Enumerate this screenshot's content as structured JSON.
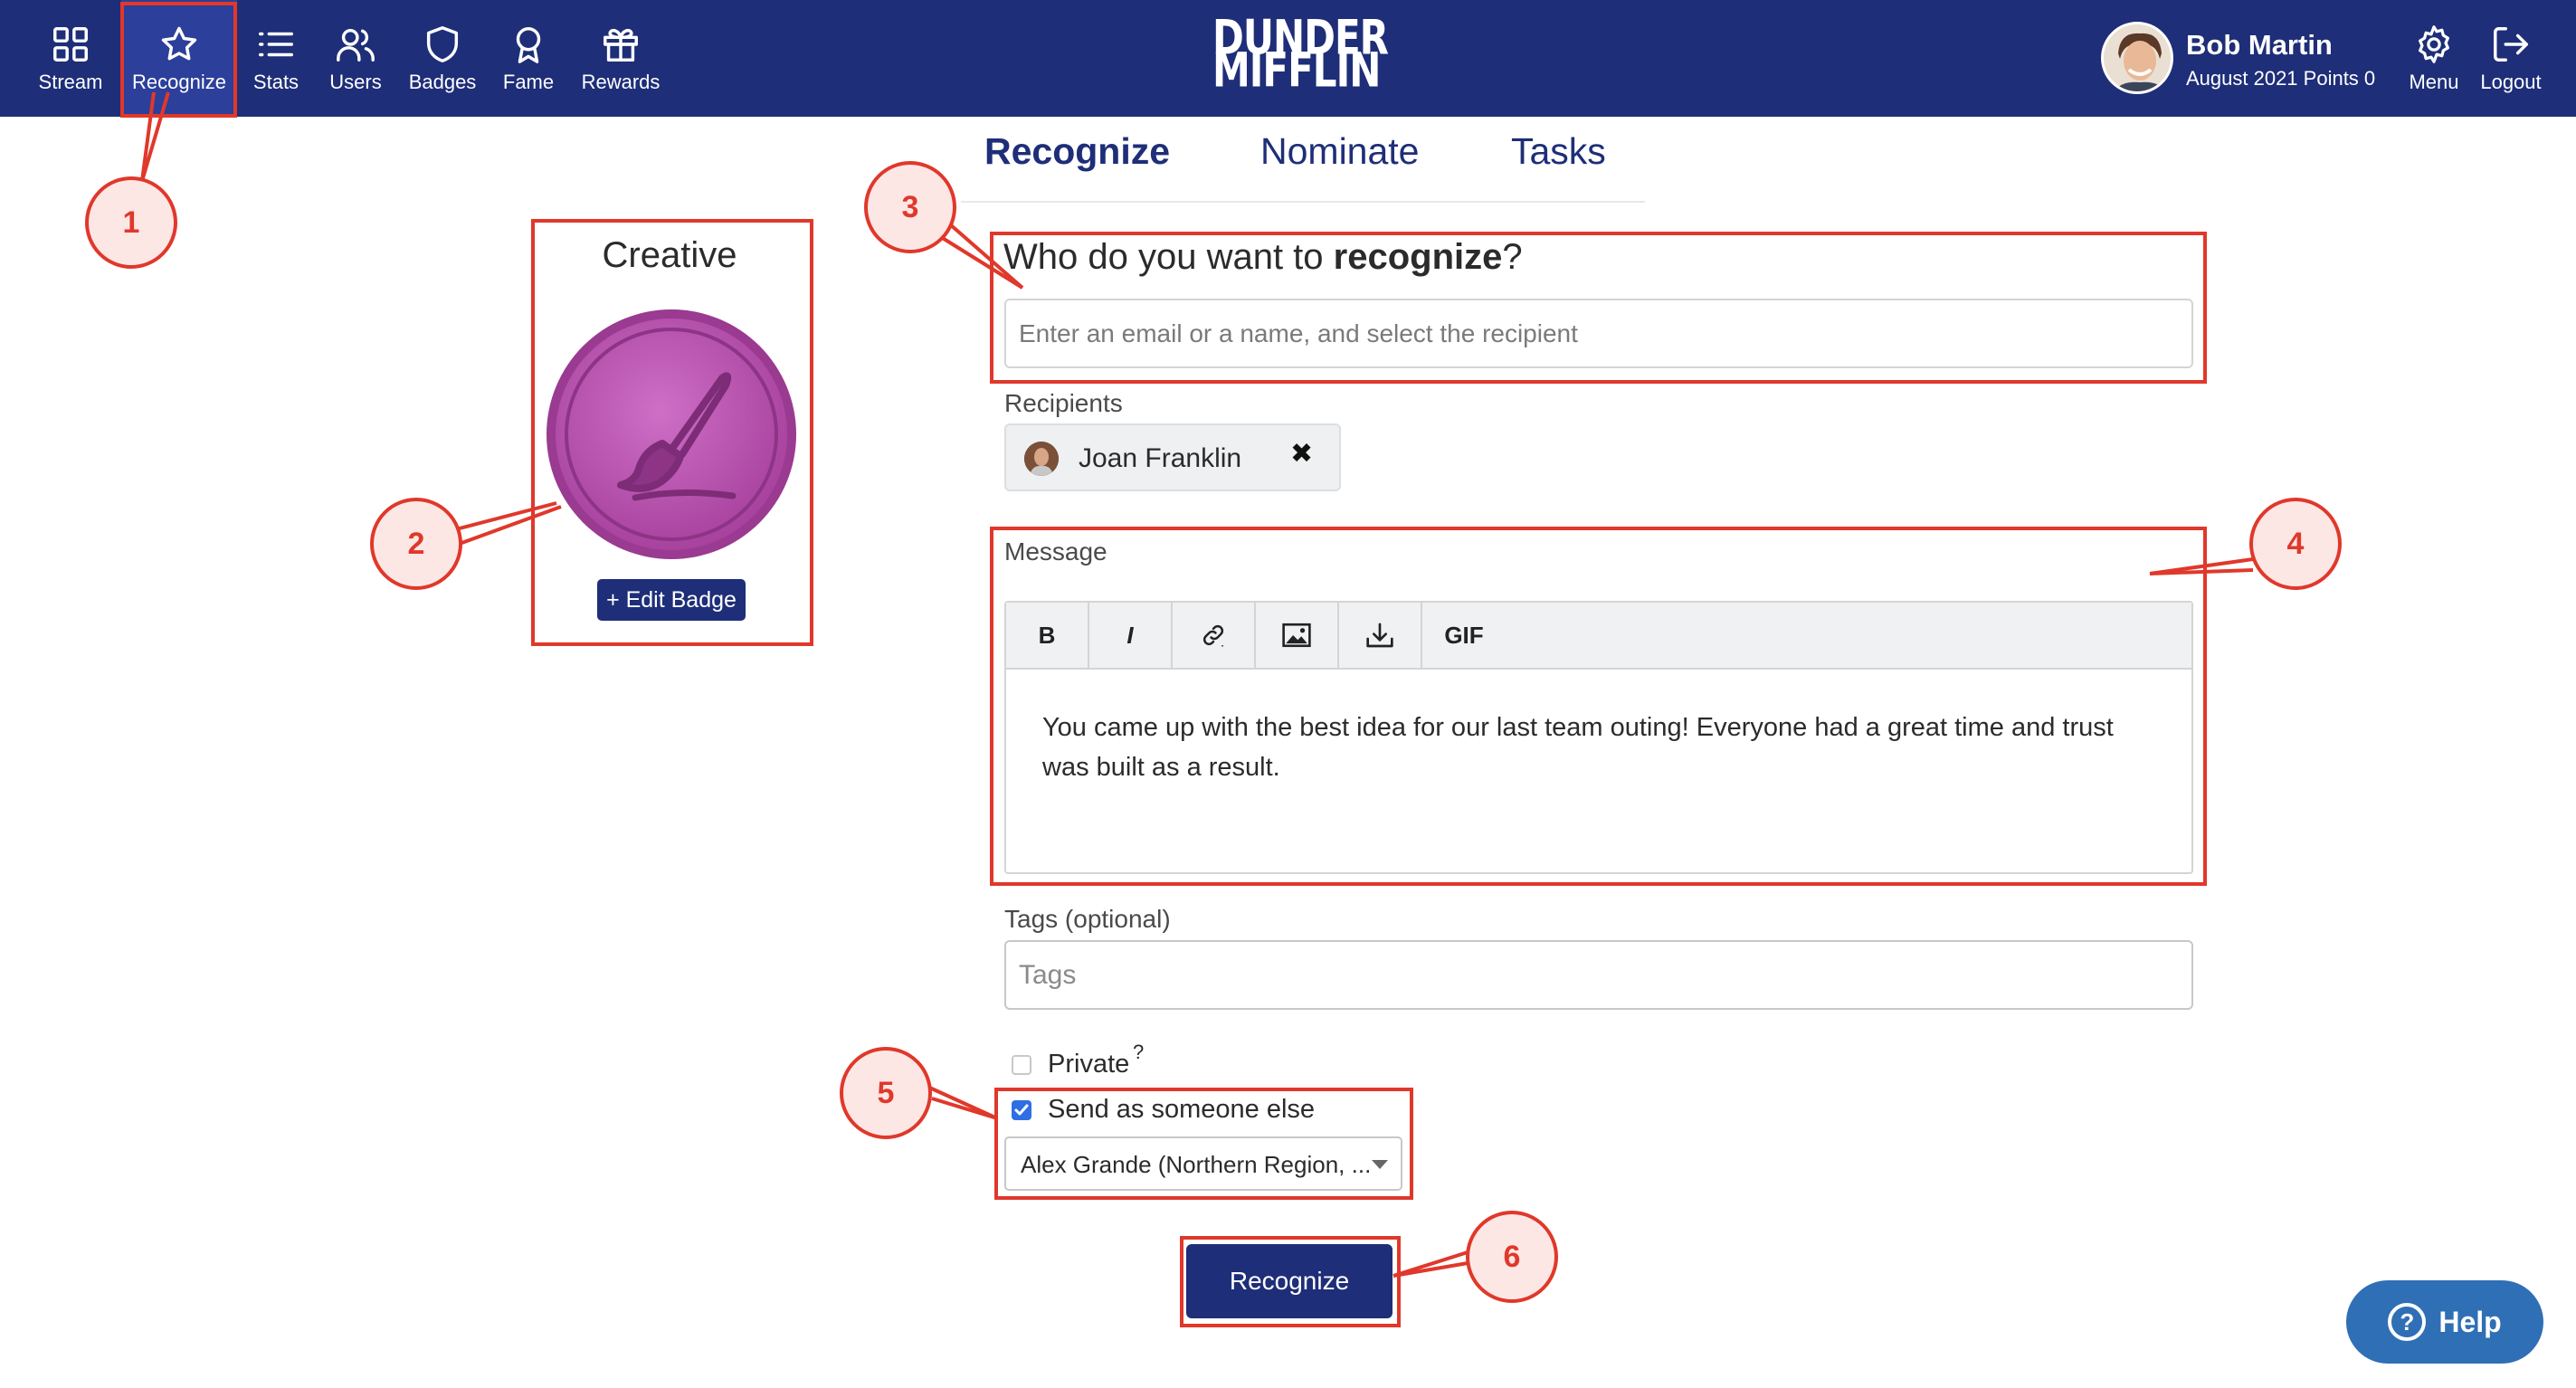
{
  "nav": {
    "items": [
      {
        "label": "Stream",
        "icon": "grid-icon"
      },
      {
        "label": "Recognize",
        "icon": "star-icon"
      },
      {
        "label": "Stats",
        "icon": "list-icon"
      },
      {
        "label": "Users",
        "icon": "users-icon"
      },
      {
        "label": "Badges",
        "icon": "shield-icon"
      },
      {
        "label": "Fame",
        "icon": "award-ribbon-icon"
      },
      {
        "label": "Rewards",
        "icon": "gift-icon"
      },
      {
        "label": "Menu",
        "icon": "gear-icon"
      },
      {
        "label": "Logout",
        "icon": "logout-icon"
      }
    ],
    "active": "Recognize"
  },
  "logo": {
    "line1": "DUNDER",
    "line2": "MIFFLIN"
  },
  "user": {
    "name": "Bob Martin",
    "points": "August 2021 Points 0"
  },
  "tabs": [
    {
      "label": "Recognize",
      "active": true
    },
    {
      "label": "Nominate",
      "active": false
    },
    {
      "label": "Tasks",
      "active": false
    }
  ],
  "badge": {
    "title": "Creative",
    "icon": "paintbrush-icon",
    "color": "#b94fae",
    "edit_label": "+ Edit Badge"
  },
  "form": {
    "question_prefix": "Who do you want to ",
    "question_emphasis": "recognize",
    "question_suffix": "?",
    "recipient_placeholder": "Enter an email or a name, and select the recipient",
    "recipients_label": "Recipients",
    "recipient_name": "Joan Franklin",
    "remove_glyph": "✖",
    "message_label": "Message",
    "toolbar": [
      "B",
      "I",
      "link-icon",
      "image-icon",
      "download-icon",
      "GIF"
    ],
    "message_text": "You came up with the best idea for our last team outing! Everyone had a great time and trust was built as a result.",
    "tags_label": "Tags (optional)",
    "tags_placeholder": "Tags",
    "private_label": "Private",
    "private_help": "?",
    "private_checked": false,
    "send_as_label": "Send as someone else",
    "send_as_checked": true,
    "send_as_value": "Alex Grande (Northern Region, ...",
    "submit_label": "Recognize"
  },
  "help": {
    "label": "Help",
    "glyph": "?"
  },
  "annotations": [
    "1",
    "2",
    "3",
    "4",
    "5",
    "6"
  ],
  "colors": {
    "nav_bg": "#1e2e78",
    "annotation": "#e0382b",
    "primary": "#1e2e78",
    "help": "#2f6fb5"
  }
}
